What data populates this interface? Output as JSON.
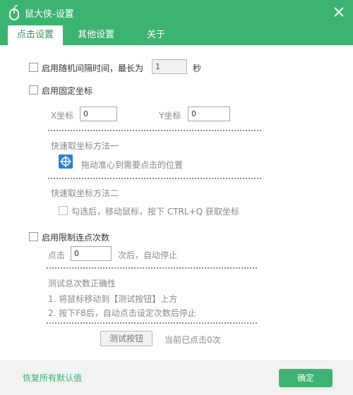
{
  "window": {
    "title": "鼠大侠-设置"
  },
  "tabs": [
    {
      "label": "点击设置",
      "active": true
    },
    {
      "label": "其他设置",
      "active": false
    },
    {
      "label": "关于",
      "active": false
    }
  ],
  "random_interval": {
    "label": "启用随机间隔时间，最长为",
    "value": "1",
    "unit": "秒",
    "checked": false
  },
  "fixed_coord": {
    "label": "启用固定坐标",
    "checked": false,
    "x_label": "X坐标",
    "x_value": "0",
    "y_label": "Y坐标",
    "y_value": "0",
    "method1_title": "快速取坐标方法一",
    "method1_text": "拖动准心到需要点击的位置",
    "method2_title": "快速取坐标方法二",
    "method2_text": "勾选后，移动鼠标，按下 CTRL+Q 获取坐标",
    "method2_checked": false
  },
  "limit_clicks": {
    "label": "启用限制连点次数",
    "checked": false,
    "click_label": "点击",
    "click_value": "0",
    "click_suffix": "次后，自动停止",
    "test_title": "测试总次数正确性",
    "test_step1": "1. 将鼠标移动到【测试按钮】上方",
    "test_step2": "2. 按下F8后，自动点击设定次数后停止",
    "test_button": "测试按钮",
    "current_clicks": "当前已点击0次"
  },
  "footer": {
    "reset_label": "恢复所有默认值",
    "ok_label": "确定"
  },
  "colors": {
    "accent": "#3cb371",
    "target_icon": "#2f7fd1"
  },
  "icons": {
    "app": "mouse-icon",
    "close": "close-icon",
    "target": "crosshair-icon"
  }
}
